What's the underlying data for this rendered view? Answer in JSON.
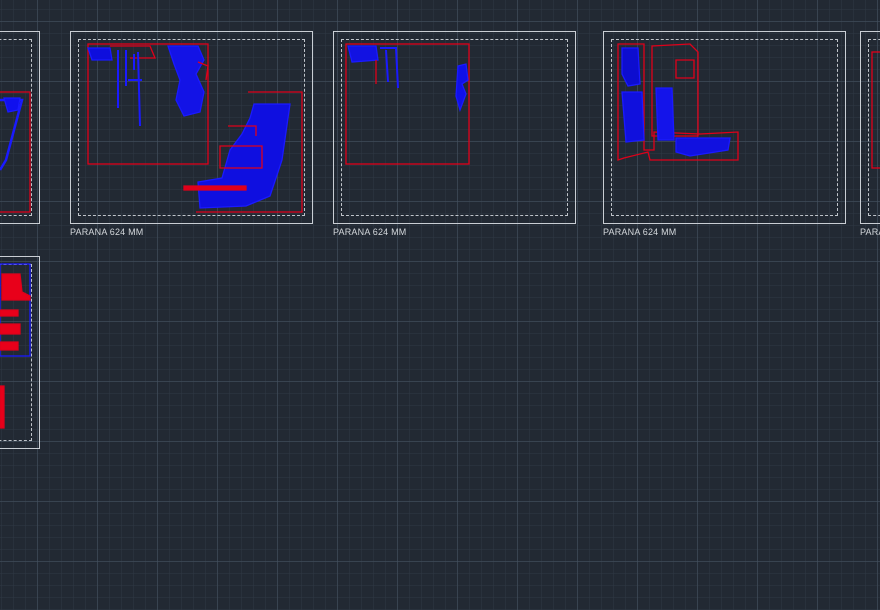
{
  "viewport": {
    "background": "#222933",
    "grid_color": "#465260",
    "sheet_border_color": "#c9ced4"
  },
  "layout_sheets": [
    {
      "label": "",
      "frame_color": "#e0001a",
      "geometry_color": "#1010ff"
    },
    {
      "label": "PARANA 624 MM",
      "frame_color": "#e0001a",
      "geometry_color": "#1010ff"
    },
    {
      "label": "PARANA 624 MM",
      "frame_color": "#e0001a",
      "geometry_color": "#1010ff"
    },
    {
      "label": "PARANA 624 MM",
      "frame_color": "#e0001a",
      "geometry_color": "#1010ff"
    },
    {
      "label": "PARA",
      "frame_color": "#e0001a",
      "geometry_color": "#1010ff"
    },
    {
      "label": "",
      "frame_color": "#e0001a",
      "geometry_color": "#1010ff"
    }
  ]
}
